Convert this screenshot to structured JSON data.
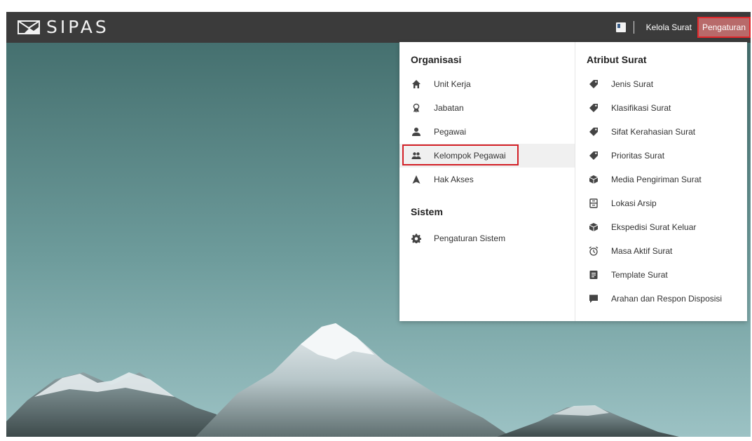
{
  "app": {
    "logo_text": "SIPAS"
  },
  "nav": {
    "kelola_label": "Kelola Surat",
    "pengaturan_label": "Pengaturan"
  },
  "menu": {
    "organisasi_title": "Organisasi",
    "organisasi_items": [
      {
        "label": "Unit Kerja",
        "icon": "home-icon"
      },
      {
        "label": "Jabatan",
        "icon": "award-icon"
      },
      {
        "label": "Pegawai",
        "icon": "person-icon"
      },
      {
        "label": "Kelompok Pegawai",
        "icon": "group-icon"
      },
      {
        "label": "Hak Akses",
        "icon": "navigation-icon"
      }
    ],
    "sistem_title": "Sistem",
    "sistem_items": [
      {
        "label": "Pengaturan Sistem",
        "icon": "gear-icon"
      }
    ],
    "atribut_title": "Atribut Surat",
    "atribut_items": [
      {
        "label": "Jenis Surat",
        "icon": "tag-icon"
      },
      {
        "label": "Klasifikasi Surat",
        "icon": "tag-icon"
      },
      {
        "label": "Sifat Kerahasian Surat",
        "icon": "tag-icon"
      },
      {
        "label": "Prioritas Surat",
        "icon": "tag-icon"
      },
      {
        "label": "Media Pengiriman Surat",
        "icon": "box-icon"
      },
      {
        "label": "Lokasi Arsip",
        "icon": "archive-icon"
      },
      {
        "label": "Ekspedisi Surat Keluar",
        "icon": "box-icon"
      },
      {
        "label": "Masa Aktif Surat",
        "icon": "alarm-icon"
      },
      {
        "label": "Template Surat",
        "icon": "document-icon"
      },
      {
        "label": "Arahan dan Respon Disposisi",
        "icon": "comment-icon"
      }
    ]
  },
  "colors": {
    "topbar": "#3b3b3b",
    "highlight_border": "#d32027",
    "active_nav": "#b86a6a",
    "icon": "#444444"
  }
}
